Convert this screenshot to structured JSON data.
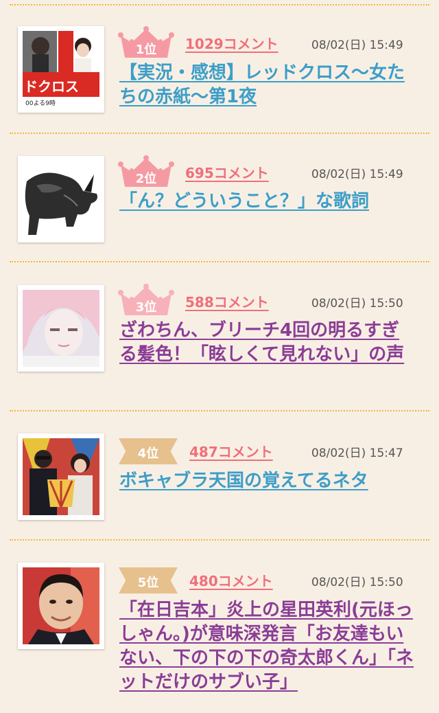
{
  "items": [
    {
      "rank": "1位",
      "comments": "1029コメント",
      "date": "08/02(日) 15:49",
      "title": "【実況・感想】レッドクロス〜女たちの赤紙〜第1夜",
      "thumb_text": "ドクロス",
      "thumb_sub": "00よる9時"
    },
    {
      "rank": "2位",
      "comments": "695コメント",
      "date": "08/02(日) 15:49",
      "title": "「ん？どういうこと？」な歌詞"
    },
    {
      "rank": "3位",
      "comments": "588コメント",
      "date": "08/02(日) 15:50",
      "title": "ざわちん、ブリーチ4回の明るすぎる髪色！「眩しくて見れない」の声"
    },
    {
      "rank": "4位",
      "comments": "487コメント",
      "date": "08/02(日) 15:47",
      "title": "ボキャブラ天国の覚えてるネタ"
    },
    {
      "rank": "5位",
      "comments": "480コメント",
      "date": "08/02(日) 15:50",
      "title": "「在日吉本」炎上の星田英利(元ほっしゃん。)が意味深発言「お友達もいない、下の下の下の奇太郎くん」「ネットだけのサブい子」"
    }
  ],
  "colors": {
    "background": "#f8efe4",
    "crown": "#f59aa3",
    "ribbon": "#e6c08d",
    "comment_count": "#ef6f7a",
    "title_blue": "#3c9ec8",
    "title_purple": "#8a3d96",
    "divider": "#f0b63a"
  }
}
